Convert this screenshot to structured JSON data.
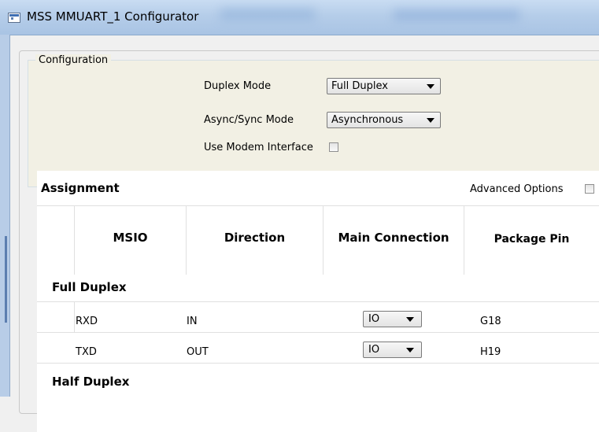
{
  "window": {
    "title": "MSS MMUART_1 Configurator",
    "icon": "app-window-icon"
  },
  "configuration": {
    "legend": "Configuration",
    "duplex_mode": {
      "label": "Duplex Mode",
      "value": "Full Duplex"
    },
    "sync_mode": {
      "label": "Async/Sync Mode",
      "value": "Asynchronous"
    },
    "modem": {
      "label": "Use Modem Interface",
      "checked": false
    }
  },
  "assignment": {
    "title": "Assignment",
    "advanced_options": {
      "label": "Advanced Options",
      "checked": false
    },
    "columns": [
      "MSIO",
      "Direction",
      "Main Connection",
      "Package Pin"
    ],
    "sections": [
      {
        "name": "Full Duplex",
        "rows": [
          {
            "msio": "RXD",
            "direction": "IN",
            "connection": "IO",
            "pin": "G18"
          },
          {
            "msio": "TXD",
            "direction": "OUT",
            "connection": "IO",
            "pin": "H19"
          }
        ]
      },
      {
        "name": "Half Duplex",
        "rows": []
      }
    ]
  },
  "colors": {
    "config_bg": "#f2f0e4",
    "titlebar": "#b5cde9",
    "grid_line": "#e0e0e0"
  }
}
